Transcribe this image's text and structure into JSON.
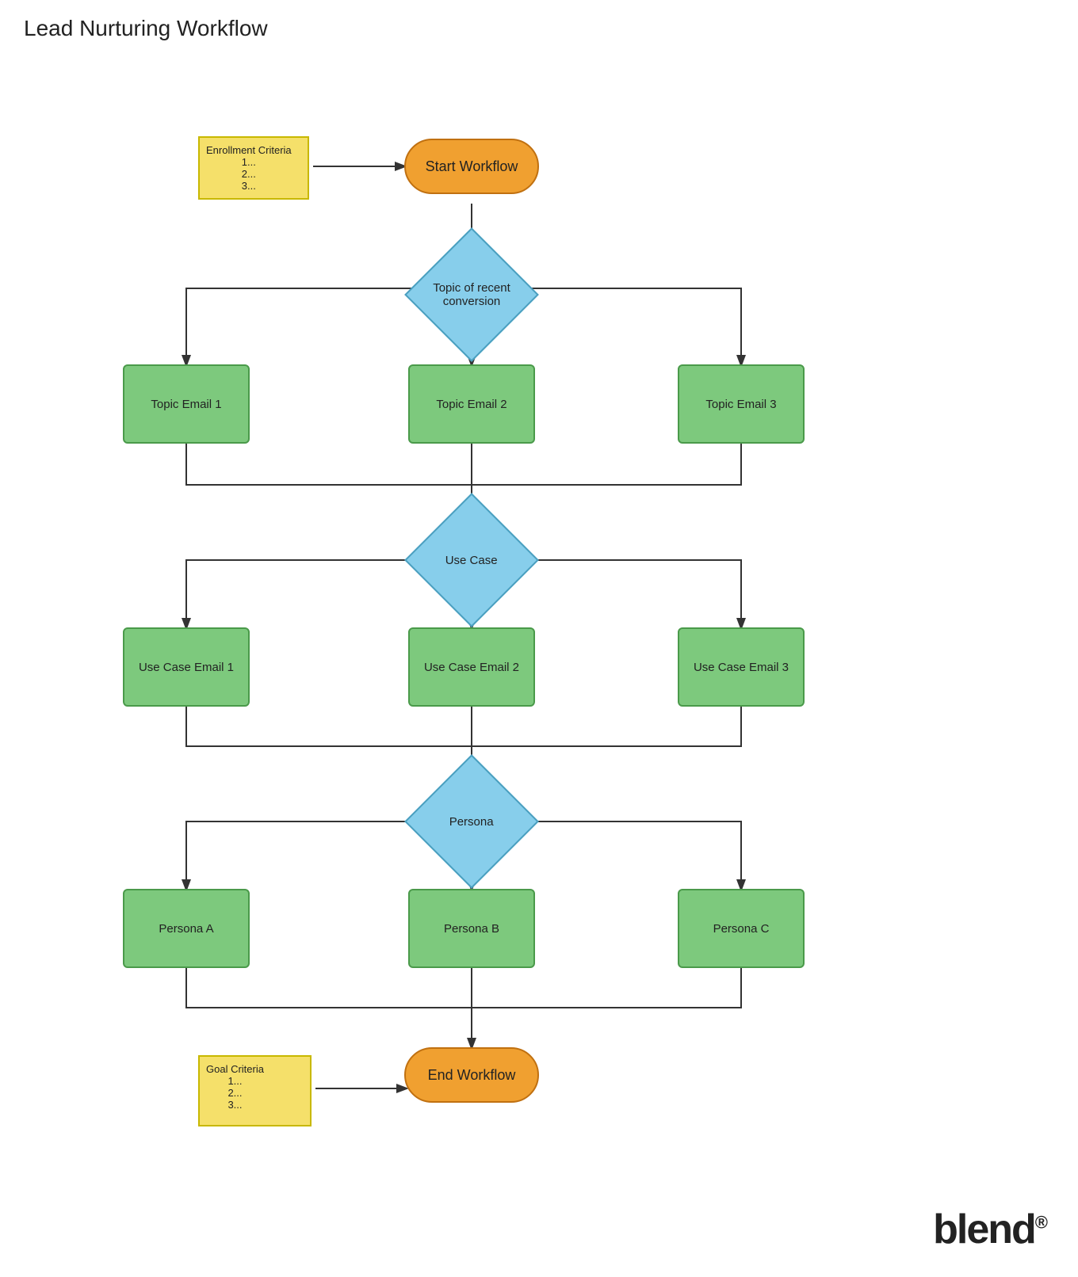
{
  "title": "Lead Nurturing Workflow",
  "nodes": {
    "start": {
      "label": "Start Workflow"
    },
    "end": {
      "label": "End Workflow"
    },
    "decision1": {
      "label": "Topic of recent conversion"
    },
    "decision2": {
      "label": "Use Case"
    },
    "decision3": {
      "label": "Persona"
    },
    "topicEmail1": {
      "label": "Topic Email 1"
    },
    "topicEmail2": {
      "label": "Topic Email 2"
    },
    "topicEmail3": {
      "label": "Topic Email 3"
    },
    "useCaseEmail1": {
      "label": "Use Case Email 1"
    },
    "useCaseEmail2": {
      "label": "Use Case Email 2"
    },
    "useCaseEmail3": {
      "label": "Use Case Email 3"
    },
    "personaA": {
      "label": "Persona A"
    },
    "personaB": {
      "label": "Persona B"
    },
    "personaC": {
      "label": "Persona C"
    },
    "enrollNote": {
      "label": "Enrollment Criteria\n1...\n2...\n3..."
    },
    "goalNote": {
      "label": "Goal Criteria\n1...\n2...\n3..."
    }
  },
  "blend_label": "blend",
  "blend_registered": "®"
}
